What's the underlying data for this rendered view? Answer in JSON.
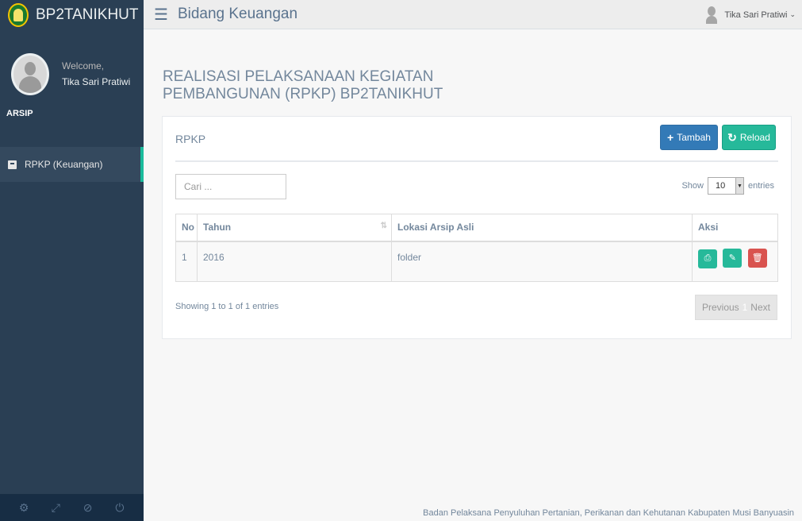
{
  "app": {
    "brand": "BP2TANIKHUT"
  },
  "sidebar": {
    "welcome": "Welcome,",
    "user_name": "Tika Sari Pratiwi",
    "section": "ARSIP",
    "items": [
      {
        "label": "RPKP (Keuangan)"
      }
    ],
    "footer_icons": [
      "gear-icon",
      "fullscreen-icon",
      "eye-slash-icon",
      "power-icon"
    ]
  },
  "topbar": {
    "title": "Bidang Keuangan",
    "user": "Tika Sari Pratiwi"
  },
  "page": {
    "title_line1": "REALISASI PELAKSANAAN KEGIATAN",
    "title_line2": "PEMBANGUNAN (RPKP) BP2TANIKHUT"
  },
  "panel": {
    "title": "RPKP",
    "add_label": "Tambah",
    "reload_label": "Reload",
    "search_placeholder": "Cari ...",
    "show_label": "Show",
    "entries_value": "10",
    "entries_label": "entries",
    "columns": [
      "No",
      "Tahun",
      "Lokasi Arsip Asli",
      "Aksi"
    ],
    "rows": [
      {
        "no": "1",
        "tahun": "2016",
        "lokasi": "folder"
      }
    ],
    "info": "Showing 1 to 1 of 1 entries",
    "prev": "Previous",
    "page": "1",
    "next": "Next"
  },
  "footer": "Badan Pelaksana Penyuluhan Pertanian, Perikanan dan Kehutanan Kabupaten Musi Banyuasin",
  "colors": {
    "sidebar": "#2a3f54",
    "active_border": "#1abb9c",
    "primary": "#337ab7",
    "success": "#26b99a",
    "danger": "#d9534f"
  }
}
